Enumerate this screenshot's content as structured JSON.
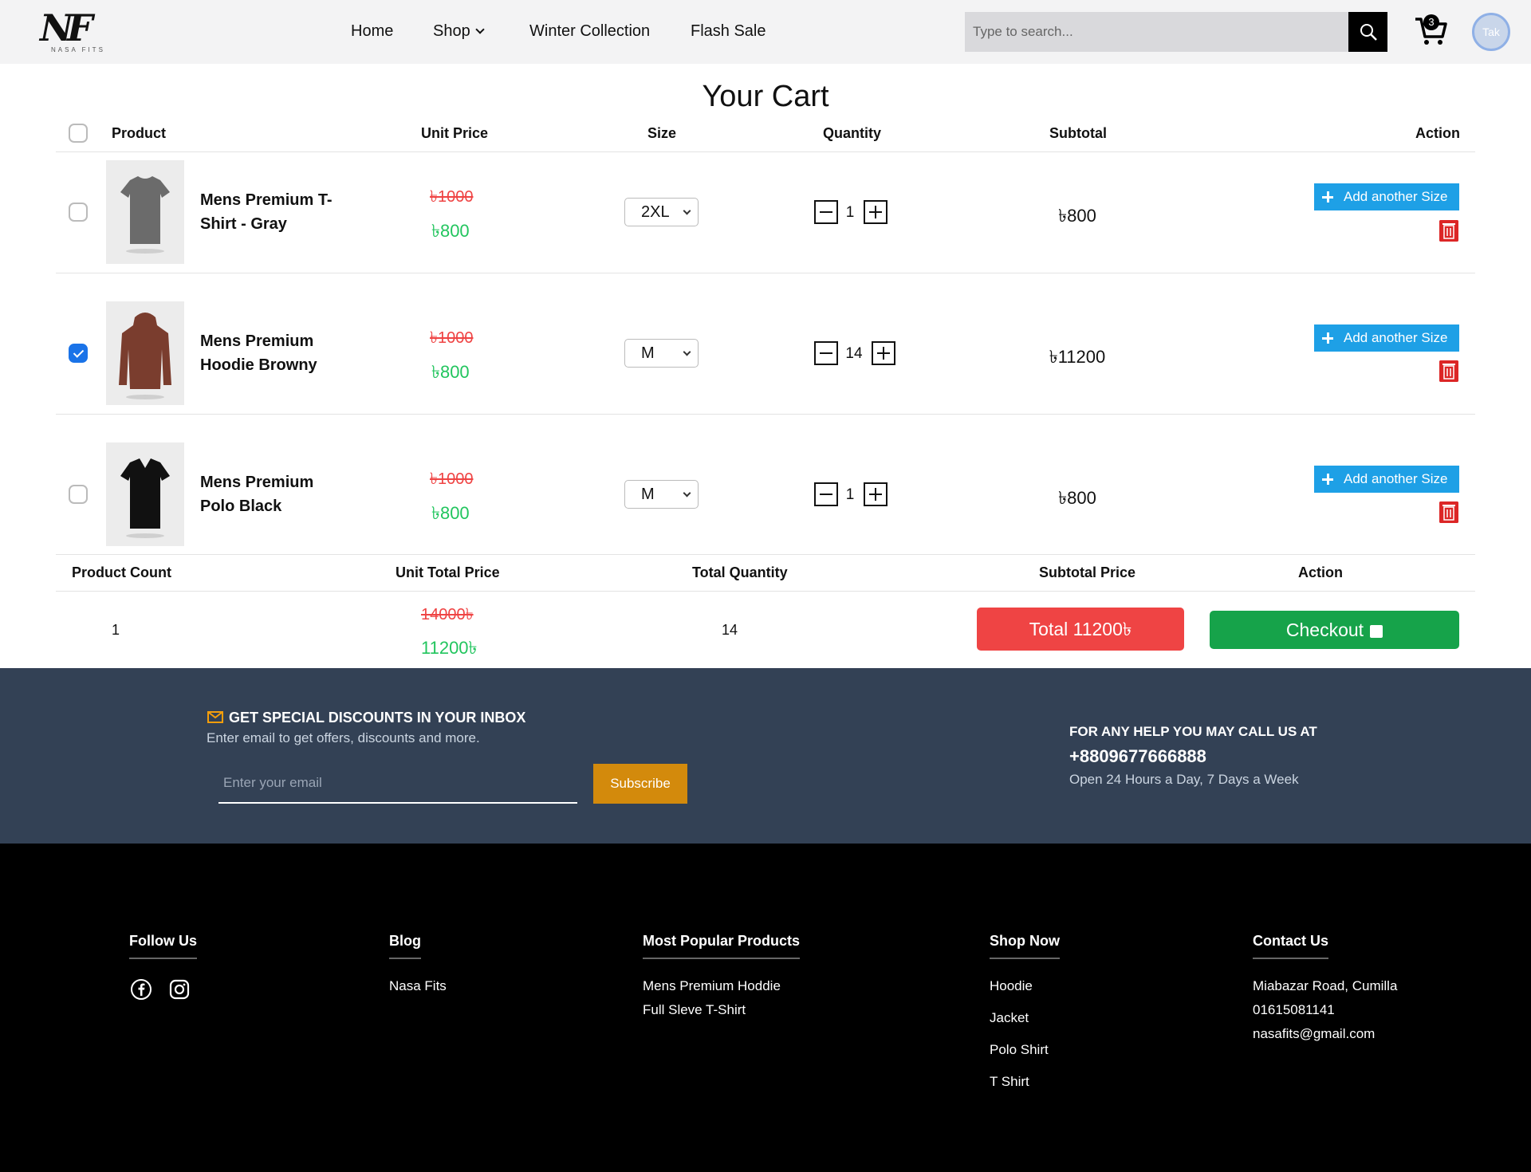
{
  "header": {
    "logo_mark": "NF",
    "logo_sub": "NASA FITS",
    "nav": [
      {
        "label": "Home"
      },
      {
        "label": "Shop"
      },
      {
        "label": "Winter Collection"
      },
      {
        "label": "Flash Sale"
      }
    ],
    "search_placeholder": "Type to search...",
    "cart_count": "3",
    "avatar_text": "Tak"
  },
  "cart": {
    "title": "Your Cart",
    "columns": {
      "product": "Product",
      "unit_price": "Unit Price",
      "size": "Size",
      "quantity": "Quantity",
      "subtotal": "Subtotal",
      "action": "Action"
    },
    "items": [
      {
        "name_line1": "Mens Premium T-",
        "name_line2": "Shirt - Gray",
        "old_price": "৳1000",
        "new_price": "৳800",
        "size": "2XL",
        "quantity": "1",
        "subtotal": "৳800",
        "checked": false,
        "add_size_label": "Add another Size",
        "color": "#6b6b6b"
      },
      {
        "name_line1": "Mens Premium",
        "name_line2": "Hoodie Browny",
        "old_price": "৳1000",
        "new_price": "৳800",
        "size": "M",
        "quantity": "14",
        "subtotal": "৳11200",
        "checked": true,
        "add_size_label": "Add another Size",
        "color": "#7a3d2e"
      },
      {
        "name_line1": "Mens Premium",
        "name_line2": "Polo Black",
        "old_price": "৳1000",
        "new_price": "৳800",
        "size": "M",
        "quantity": "1",
        "subtotal": "৳800",
        "checked": false,
        "add_size_label": "Add another Size",
        "color": "#111111"
      }
    ],
    "summary": {
      "headers": {
        "product_count": "Product Count",
        "unit_total_price": "Unit Total Price",
        "total_quantity": "Total Quantity",
        "subtotal_price": "Subtotal Price",
        "action": "Action"
      },
      "product_count": "1",
      "unit_total_old": "14000৳",
      "unit_total_new": "11200৳",
      "total_quantity": "14",
      "total_button": "Total 11200৳",
      "checkout_button": "Checkout"
    }
  },
  "newsletter": {
    "title": "GET SPECIAL DISCOUNTS IN YOUR INBOX",
    "subtitle": "Enter email to get offers, discounts and more.",
    "email_placeholder": "Enter your email",
    "subscribe_label": "Subscribe",
    "help_title": "FOR ANY HELP YOU MAY CALL US AT",
    "help_phone": "+8809677666888",
    "help_hours": "Open 24 Hours a Day, 7 Days a Week"
  },
  "footer": {
    "follow_title": "Follow Us",
    "blog_title": "Blog",
    "blog_links": [
      "Nasa Fits"
    ],
    "popular_title": "Most Popular Products",
    "popular_links": [
      "Mens Premium Hoddie",
      "Full Sleve T-Shirt"
    ],
    "shop_title": "Shop Now",
    "shop_links": [
      "Hoodie",
      "Jacket",
      "Polo Shirt",
      "T Shirt"
    ],
    "contact_title": "Contact Us",
    "contact_lines": [
      "Miabazar Road, Cumilla",
      "01615081141",
      "nasafits@gmail.com"
    ]
  },
  "colors": {
    "accent_blue": "#1ea0e6",
    "price_old": "#ef4444",
    "price_new": "#22c55e",
    "total_red": "#ef4444",
    "checkout_green": "#16a34a",
    "newsletter_bg": "#334155",
    "subscribe_bg": "#d38a0c"
  },
  "icons": [
    "search-icon",
    "cart-icon",
    "chevron-down-icon",
    "plus-icon",
    "minus-icon",
    "trash-icon",
    "mail-icon",
    "bag-icon",
    "facebook-icon",
    "instagram-icon"
  ]
}
